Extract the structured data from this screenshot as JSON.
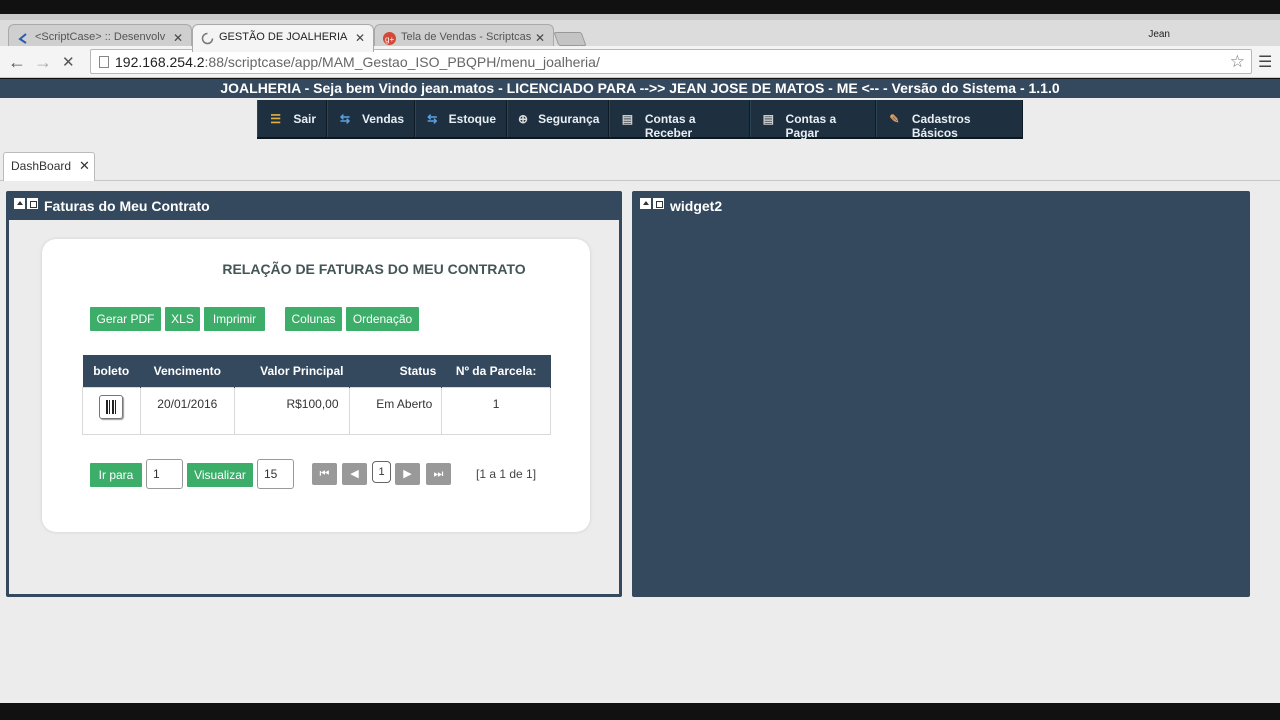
{
  "browser": {
    "tabs": [
      {
        "title": "<ScriptCase> :: Desenvolv",
        "favicon": "scriptcase-icon"
      },
      {
        "title": "GESTÃO DE JOALHERIA",
        "favicon": "loading-icon"
      },
      {
        "title": "Tela de Vendas - Scriptcas",
        "favicon": "google-plus-icon"
      }
    ],
    "user": "Jean",
    "url_host": "192.168.254.2",
    "url_path": ":88/scriptcase/app/MAM_Gestao_ISO_PBQPH/menu_joalheria/"
  },
  "app": {
    "header": "JOALHERIA - Seja bem Vindo jean.matos - LICENCIADO PARA -->> JEAN JOSE DE MATOS - ME <-- - Versão do Sistema - 1.1.0",
    "menu": [
      {
        "label": "Sair",
        "icon": "sliders-icon"
      },
      {
        "label": "Vendas",
        "icon": "arrows-icon"
      },
      {
        "label": "Estoque",
        "icon": "arrows-icon"
      },
      {
        "label": "Segurança",
        "icon": "lifebuoy-icon"
      },
      {
        "label": "Contas a Receber",
        "icon": "money-icon"
      },
      {
        "label": "Contas a Pagar",
        "icon": "money-icon"
      },
      {
        "label": "Cadastros Básicos",
        "icon": "book-icon"
      }
    ],
    "tab": "DashBoard",
    "widget1": {
      "title": "Faturas do Meu Contrato",
      "report_title": "RELAÇÃO DE FATURAS DO MEU CONTRATO",
      "buttons": [
        "Gerar PDF",
        "XLS",
        "Imprimir",
        "Colunas",
        "Ordenação"
      ],
      "columns": [
        "boleto",
        "Vencimento",
        "Valor Principal",
        "Status",
        "Nº da Parcela:"
      ],
      "rows": [
        {
          "vencimento": "20/01/2016",
          "valor": "R$100,00",
          "status": "Em Aberto",
          "parcela": "1"
        }
      ],
      "goto_label": "Ir para",
      "goto_value": "1",
      "view_label": "Visualizar",
      "view_value": "15",
      "page": "1",
      "page_info": "[1 a 1 de 1]"
    },
    "widget2": {
      "title": "widget2"
    }
  }
}
